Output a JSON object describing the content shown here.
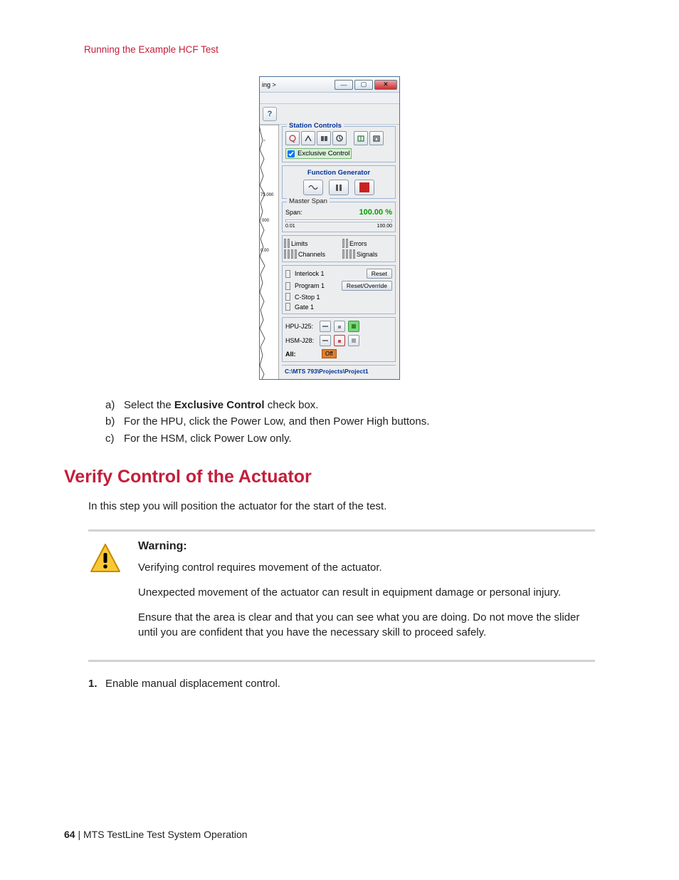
{
  "breadcrumb": "Running the Example HCF Test",
  "window": {
    "title_frag": "ing >",
    "help_btn": "?",
    "station_controls": {
      "legend": "Station Controls",
      "exclusive_control": "Exclusive Control"
    },
    "function_generator": {
      "legend": "Function Generator"
    },
    "master_span": {
      "legend": "Master Span",
      "label": "Span:",
      "value": "100.00 %",
      "min": "0.01",
      "max": "100.00"
    },
    "signals_grid": {
      "limits": "Limits",
      "errors": "Errors",
      "channels": "Channels",
      "signals": "Signals"
    },
    "status": {
      "interlock": "Interlock 1",
      "reset": "Reset",
      "program": "Program 1",
      "reset_override": "Reset/Override",
      "cstop": "C-Stop 1",
      "gate": "Gate 1"
    },
    "power": {
      "hpu": "HPU-J25:",
      "hsm": "HSM-J28:",
      "all": "All:",
      "off": "Off"
    },
    "footer_path": "C:\\MTS 793\\Projects\\Project1"
  },
  "instructions": {
    "a": {
      "label": "a)",
      "pre": "Select the ",
      "bold": "Exclusive Control",
      "post": " check box."
    },
    "b": {
      "label": "b)",
      "text": "For the HPU, click the Power Low, and then Power High buttons."
    },
    "c": {
      "label": "c)",
      "text": "For the HSM, click Power Low only."
    }
  },
  "section_title": "Verify Control of the Actuator",
  "section_intro": "In this step you will position the actuator for the start of the test.",
  "warning": {
    "title": "Warning:",
    "p1": "Verifying control requires movement of the actuator.",
    "p2": "Unexpected movement of the actuator can result in equipment damage or personal injury.",
    "p3": "Ensure that the area is clear and that you can see what you are doing. Do not move the slider until you are confident that you have the necessary skill to proceed safely."
  },
  "step1": {
    "num": "1.",
    "text": "Enable manual displacement control."
  },
  "footer": {
    "page": "64",
    "sep": " | ",
    "title": "MTS TestLine Test System Operation"
  }
}
